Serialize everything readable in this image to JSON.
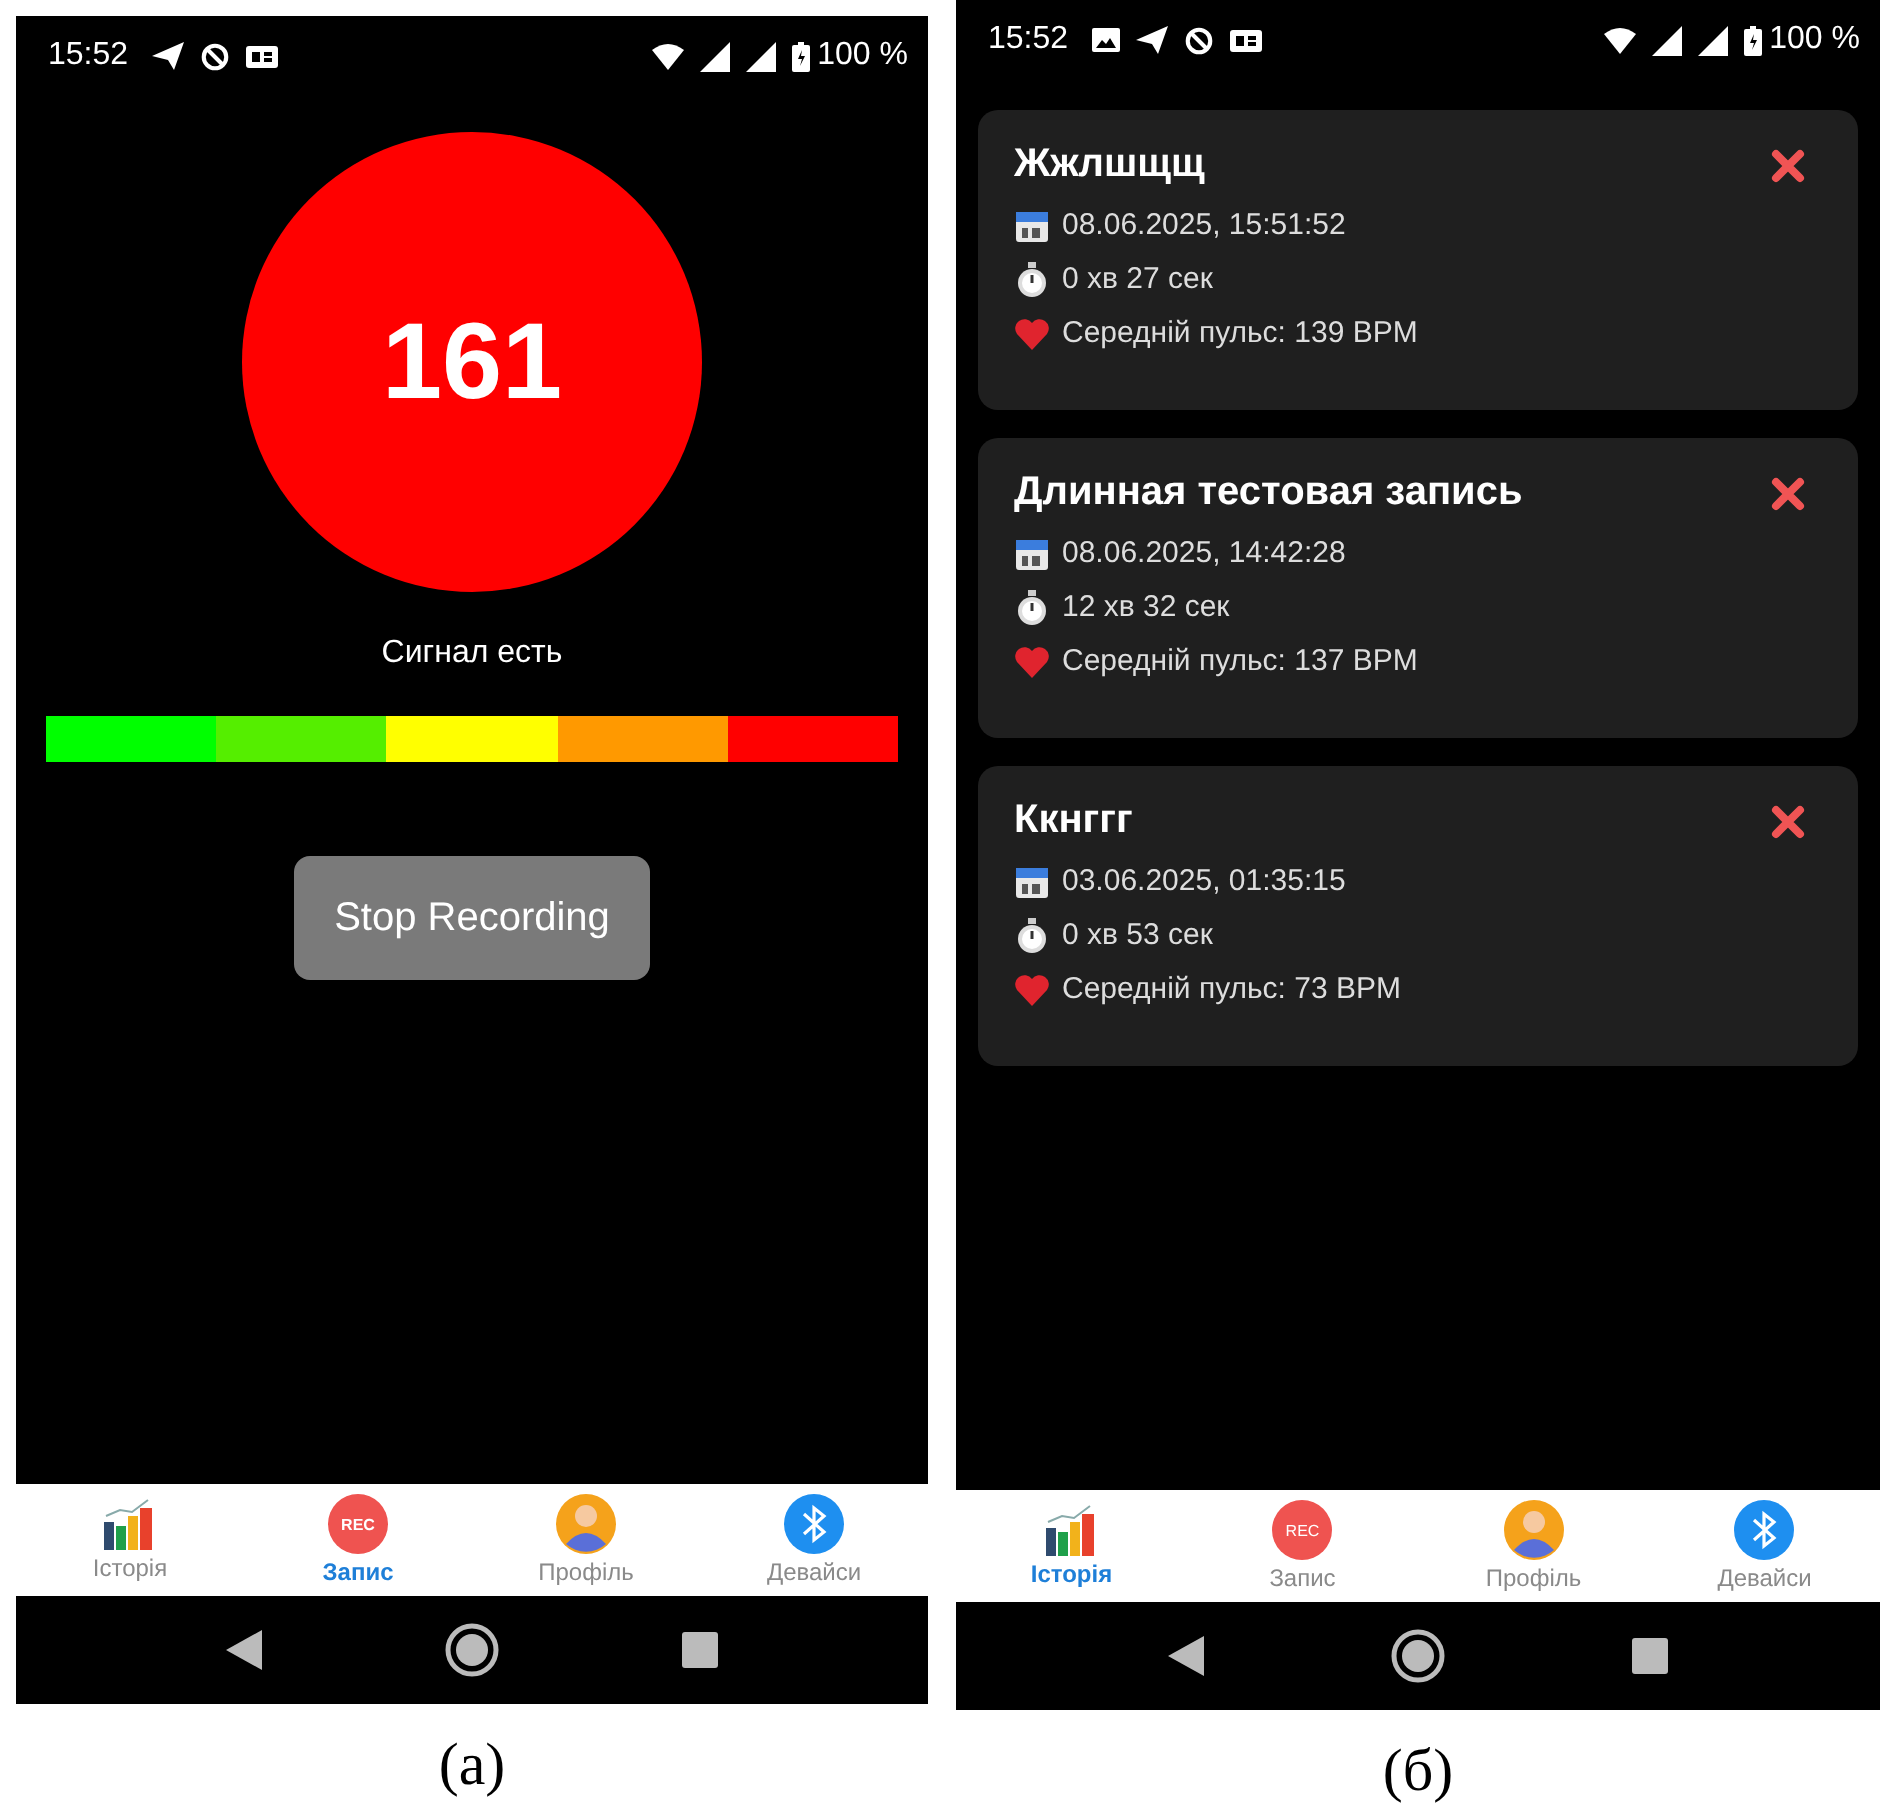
{
  "panels": [
    {
      "caption": "(а)",
      "kind": "recording",
      "status_bar": {
        "time": "15:52",
        "icons": [
          {
            "kind": "telegram"
          },
          {
            "kind": "vpn"
          },
          {
            "kind": "sim"
          }
        ],
        "battery": "100 %"
      },
      "pulse": "161",
      "signal_text": "Сигнал есть",
      "meter_segments": [
        {
          "color": "#00ff00"
        },
        {
          "color": "#55ee00"
        },
        {
          "color": "#ffff00"
        },
        {
          "color": "#ff9900"
        },
        {
          "color": "#ff0000"
        }
      ],
      "button": "Stop Recording",
      "nav": [
        {
          "label": "Історія",
          "kind": "chart",
          "selected": false
        },
        {
          "label": "Запис",
          "kind": "rec",
          "badge": "REC",
          "selected": true
        },
        {
          "label": "Профіль",
          "kind": "profile",
          "selected": false
        },
        {
          "label": "Девайси",
          "kind": "bluetooth",
          "selected": false
        }
      ]
    },
    {
      "caption": "(б)",
      "kind": "history",
      "status_bar": {
        "time": "15:52",
        "icons": [
          {
            "kind": "image"
          },
          {
            "kind": "telegram"
          },
          {
            "kind": "vpn"
          },
          {
            "kind": "sim"
          }
        ],
        "battery": "100 %"
      },
      "records": [
        {
          "title": "Жжлшщщ",
          "date": "08.06.2025, 15:51:52",
          "duration": "0 хв 27 сек",
          "pulse": "Середній пульс: 139 BPM"
        },
        {
          "title": "Длинная тестовая запись",
          "date": "08.06.2025, 14:42:28",
          "duration": "12 хв 32 сек",
          "pulse": "Середній пульс: 137 BPM"
        },
        {
          "title": "Ккнггг",
          "date": "03.06.2025, 01:35:15",
          "duration": "0 хв 53 сек",
          "pulse": "Середній пульс: 73 BPM"
        }
      ],
      "nav": [
        {
          "label": "Історія",
          "kind": "chart",
          "selected": true
        },
        {
          "label": "Запис",
          "kind": "rec",
          "badge": "REC",
          "selected": false
        },
        {
          "label": "Профіль",
          "kind": "profile",
          "selected": false
        },
        {
          "label": "Девайси",
          "kind": "bluetooth",
          "selected": false
        }
      ]
    }
  ]
}
